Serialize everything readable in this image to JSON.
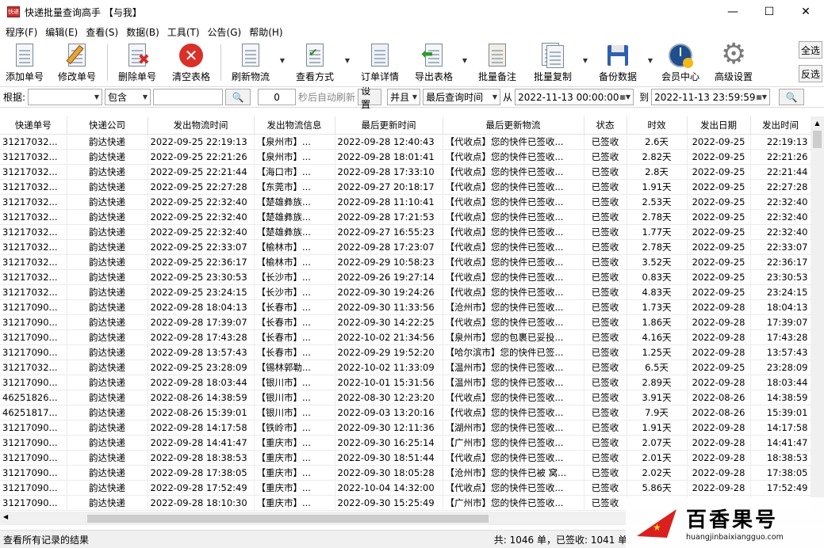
{
  "window": {
    "title": "快递批量查询高手 【与我】",
    "icon_text": "快递"
  },
  "menu": [
    "程序(F)",
    "编辑(E)",
    "查看(S)",
    "数据(B)",
    "工具(T)",
    "公告(G)",
    "帮助(H)"
  ],
  "toolbar": {
    "add": "添加单号",
    "edit": "修改单号",
    "delete": "删除单号",
    "clear": "清空表格",
    "refresh": "刷新物流",
    "view_mode": "查看方式",
    "order_detail": "订单详情",
    "export": "导出表格",
    "batch_note": "批量备注",
    "batch_copy": "批量复制",
    "backup": "备份数据",
    "member": "会员中心",
    "advanced": "高级设置",
    "select_all": "全选",
    "invert": "反选"
  },
  "filter": {
    "label": "根据:",
    "field_value": "",
    "op_value": "包含",
    "keyword": "",
    "seconds": "0",
    "auto_refresh": "秒后自动刷新",
    "settings": "设置",
    "logic": "并且",
    "time_field": "最后查询时间",
    "from_label": "从",
    "from": "2022-11-13 00:00:00",
    "to_label": "到",
    "to": "2022-11-13 23:59:59"
  },
  "table": {
    "headers": [
      "快递单号",
      "快递公司",
      "发出物流时间",
      "发出物流信息",
      "最后更新时间",
      "最后更新物流",
      "状态",
      "时效",
      "发出日期",
      "发出时间"
    ],
    "rows": [
      [
        "31217032...",
        "韵达快递",
        "2022-09-25 22:19:13",
        "【泉州市】...",
        "2022-09-28 12:40:43",
        "【代收点】您的快件已签收...",
        "已签收",
        "2.6天",
        "2022-09-25",
        "22:19:13"
      ],
      [
        "31217032...",
        "韵达快递",
        "2022-09-25 22:21:26",
        "【泉州市】...",
        "2022-09-28 18:01:41",
        "【代收点】您的快件已签收...",
        "已签收",
        "2.82天",
        "2022-09-25",
        "22:21:26"
      ],
      [
        "31217032...",
        "韵达快递",
        "2022-09-25 22:21:44",
        "【海口市】...",
        "2022-09-28 17:33:10",
        "【代收点】您的快件已签收...",
        "已签收",
        "2.8天",
        "2022-09-25",
        "22:21:44"
      ],
      [
        "31217032...",
        "韵达快递",
        "2022-09-25 22:27:28",
        "【东莞市】...",
        "2022-09-27 20:18:17",
        "【代收点】您的快件已签收...",
        "已签收",
        "1.91天",
        "2022-09-25",
        "22:27:28"
      ],
      [
        "31217032...",
        "韵达快递",
        "2022-09-25 22:32:40",
        "【楚雄彝族...",
        "2022-09-28 11:10:41",
        "【代收点】您的快件已签收...",
        "已签收",
        "2.53天",
        "2022-09-25",
        "22:32:40"
      ],
      [
        "31217032...",
        "韵达快递",
        "2022-09-25 22:32:40",
        "【楚雄彝族...",
        "2022-09-28 17:21:53",
        "【代收点】您的快件已签收...",
        "已签收",
        "2.78天",
        "2022-09-25",
        "22:32:40"
      ],
      [
        "31217032...",
        "韵达快递",
        "2022-09-25 22:32:40",
        "【楚雄彝族...",
        "2022-09-27 16:55:23",
        "【代收点】您的快件已签收...",
        "已签收",
        "1.77天",
        "2022-09-25",
        "22:32:40"
      ],
      [
        "31217032...",
        "韵达快递",
        "2022-09-25 22:33:07",
        "【榆林市】...",
        "2022-09-28 17:23:07",
        "【代收点】您的快件已签收...",
        "已签收",
        "2.78天",
        "2022-09-25",
        "22:33:07"
      ],
      [
        "31217032...",
        "韵达快递",
        "2022-09-25 22:36:17",
        "【榆林市】...",
        "2022-09-29 10:58:23",
        "【代收点】您的快件已签收...",
        "已签收",
        "3.52天",
        "2022-09-25",
        "22:36:17"
      ],
      [
        "31217032...",
        "韵达快递",
        "2022-09-25 23:30:53",
        "【长沙市】...",
        "2022-09-26 19:27:14",
        "【代收点】您的快件已签收...",
        "已签收",
        "0.83天",
        "2022-09-25",
        "23:30:53"
      ],
      [
        "31217032...",
        "韵达快递",
        "2022-09-25 23:24:15",
        "【长沙市】...",
        "2022-09-30 19:24:26",
        "【代收点】您的快件已签收...",
        "已签收",
        "4.83天",
        "2022-09-25",
        "23:24:15"
      ],
      [
        "31217090...",
        "韵达快递",
        "2022-09-28 18:04:13",
        "【长春市】...",
        "2022-09-30 11:33:56",
        "【沧州市】您的快件已签收...",
        "已签收",
        "1.73天",
        "2022-09-28",
        "18:04:13"
      ],
      [
        "31217090...",
        "韵达快递",
        "2022-09-28 17:39:07",
        "【长春市】...",
        "2022-09-30 14:22:25",
        "【代收点】您的快件已签收...",
        "已签收",
        "1.86天",
        "2022-09-28",
        "17:39:07"
      ],
      [
        "31217090...",
        "韵达快递",
        "2022-09-28 17:43:28",
        "【长春市】...",
        "2022-10-02 21:34:56",
        "【泉州市】您的包裹已妥投...",
        "已签收",
        "4.16天",
        "2022-09-28",
        "17:43:28"
      ],
      [
        "31217090...",
        "韵达快递",
        "2022-09-28 13:57:43",
        "【长春市】...",
        "2022-09-29 19:52:20",
        "【哈尔滨市】您的快件已签...",
        "已签收",
        "1.25天",
        "2022-09-28",
        "13:57:43"
      ],
      [
        "31217032...",
        "韵达快递",
        "2022-09-25 23:28:09",
        "【锡林郭勒...",
        "2022-10-02 11:33:09",
        "【温州市】您的快件已签收...",
        "已签收",
        "6.5天",
        "2022-09-25",
        "23:28:09"
      ],
      [
        "31217090...",
        "韵达快递",
        "2022-09-28 18:03:44",
        "【银川市】...",
        "2022-10-01 15:31:56",
        "【温州市】您的快件已签收...",
        "已签收",
        "2.89天",
        "2022-09-28",
        "18:03:44"
      ],
      [
        "46251826...",
        "韵达快递",
        "2022-08-26 14:38:59",
        "【银川市】...",
        "2022-08-30 12:23:20",
        "【代收点】您的快件已签收...",
        "已签收",
        "3.91天",
        "2022-08-26",
        "14:38:59"
      ],
      [
        "46251817...",
        "韵达快递",
        "2022-08-26 15:39:01",
        "【银川市】...",
        "2022-09-03 13:20:16",
        "【代收点】您的快件已签收...",
        "已签收",
        "7.9天",
        "2022-08-26",
        "15:39:01"
      ],
      [
        "31217090...",
        "韵达快递",
        "2022-09-28 14:17:58",
        "【铁岭市】...",
        "2022-09-30 12:11:36",
        "【湖州市】您的快件已签收...",
        "已签收",
        "1.91天",
        "2022-09-28",
        "14:17:58"
      ],
      [
        "31217090...",
        "韵达快递",
        "2022-09-28 14:41:47",
        "【重庆市】...",
        "2022-09-30 16:25:14",
        "【广州市】您的快件已签收...",
        "已签收",
        "2.07天",
        "2022-09-28",
        "14:41:47"
      ],
      [
        "31217090...",
        "韵达快递",
        "2022-09-28 18:38:53",
        "【重庆市】...",
        "2022-09-30 18:51:44",
        "【代收点】您的快件已签收...",
        "已签收",
        "2.01天",
        "2022-09-28",
        "18:38:53"
      ],
      [
        "31217090...",
        "韵达快递",
        "2022-09-28 17:38:05",
        "【重庆市】...",
        "2022-09-30 18:05:28",
        "【沧州市】您的快件已被 窝...",
        "已签收",
        "2.02天",
        "2022-09-28",
        "17:38:05"
      ],
      [
        "31217090...",
        "韵达快递",
        "2022-09-28 17:52:49",
        "【重庆市】...",
        "2022-10-04 14:32:00",
        "【代收点】您的快件已签收...",
        "已签收",
        "5.86天",
        "2022-09-28",
        "17:52:49"
      ],
      [
        "31217090...",
        "韵达快递",
        "2022-09-28 18:10:30",
        "【重庆市】...",
        "2022-09-30 15:25:49",
        "【广州市】您的快件已签收...",
        "已签收",
        "",
        "",
        ""
      ]
    ]
  },
  "status": {
    "left": "查看所有记录的结果",
    "right": "共: 1046 单，已签收: 1041 单,"
  },
  "watermark": {
    "cn": "百香果号",
    "url": "huangjinbaixiangguo.com"
  },
  "colors": {
    "accent_red": "#c9302c",
    "select_blue": "#0078d7"
  }
}
